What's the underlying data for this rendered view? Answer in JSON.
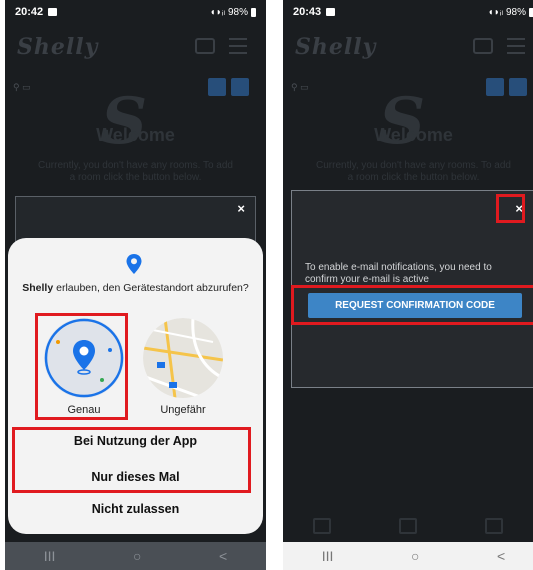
{
  "screen1": {
    "status": {
      "time": "20:42",
      "battery": "98%"
    },
    "logo": "Shelly",
    "welcome": "Welcome",
    "description": "Currently, you don't have any rooms. To add a room click the button below.",
    "close": "×",
    "sheet": {
      "app_name": "Shelly",
      "question": " erlauben, den Gerätestandort abzurufen?",
      "precise_label": "Genau",
      "approx_label": "Ungefähr",
      "choice_app": "Bei Nutzung der App",
      "choice_once": "Nur dieses Mal",
      "choice_deny": "Nicht zulassen"
    },
    "nav": {
      "recent": "III",
      "home": "○",
      "back": "<"
    }
  },
  "screen2": {
    "status": {
      "time": "20:43",
      "battery": "98%"
    },
    "logo": "Shelly",
    "welcome": "Welcome",
    "description": "Currently, you don't have any rooms. To add a room click the button below.",
    "close": "×",
    "notification_text": "To enable e-mail notifications, you need to confirm your e-mail is active",
    "confirm_button": "REQUEST CONFIRMATION CODE",
    "nav": {
      "recent": "III",
      "home": "○",
      "back": "<"
    }
  },
  "colors": {
    "highlight": "#e01a1f",
    "accent": "#3d85c6",
    "dark_bg": "#1a1d20"
  }
}
